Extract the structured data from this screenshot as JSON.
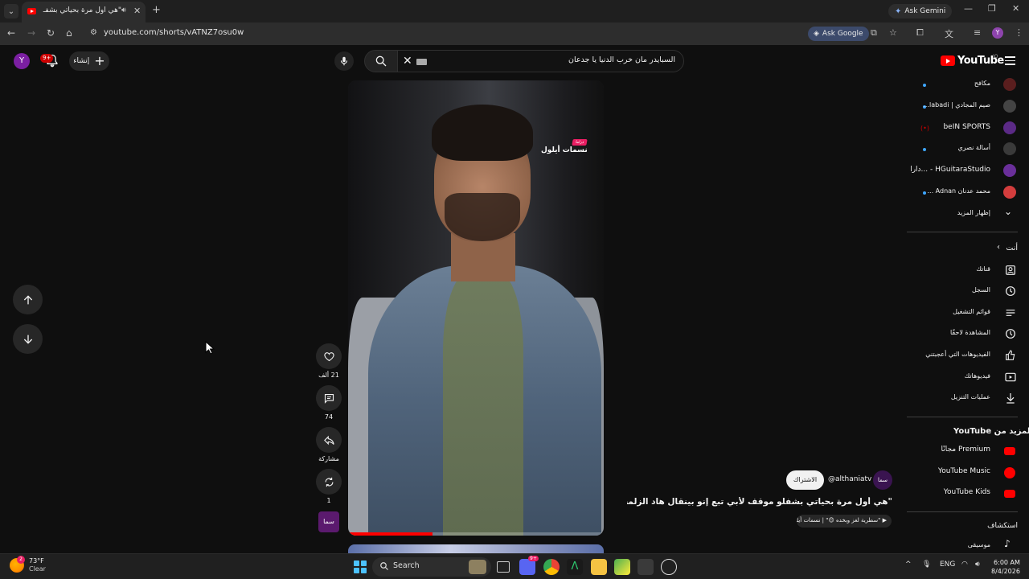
{
  "browser": {
    "tab_title": "\"هي أول مرة بحياتي بشفـ (9)",
    "new_tab_symbol": "+",
    "ask_gemini": "Ask Gemini",
    "url": "youtube.com/shorts/vATNZ7osu0w",
    "ask_google": "Ask Google",
    "profile_letter": "Y"
  },
  "header": {
    "avatar_letter": "Y",
    "notifications_badge": "9+",
    "create_label": "إنشاء",
    "search_query": "السبايدر مان خرب الدنيا يا جدعان",
    "logo_text": "YouTube",
    "logo_country": "JO"
  },
  "short": {
    "like_count": "21 ألف",
    "comment_count": "74",
    "share_label": "مشاركة",
    "remix_count": "1",
    "channel_thumb_text": "سما",
    "subscribe_label": "الاشتراك",
    "channel_handle": "@althaniatv",
    "title": "\"هي أول مرة بحياتي بشفلو موقف لأبي تبع إنو بينقال هاد الزلمة بينحط ...",
    "music": "\"سطرية لغز وبخده 😊\" | نسمات أيلول",
    "video_overlay_small": "دراما",
    "video_overlay_logo": "نسمات أيلول",
    "progress": 0.33
  },
  "sidebar": {
    "subscriptions": [
      {
        "label": "مكافح",
        "dot": true,
        "icon_color": "#5a1e1e"
      },
      {
        "label": "صيم المجادي | labadi...",
        "dot": true,
        "icon_color": "#444444"
      },
      {
        "label": "beIN SPORTS",
        "dot": false,
        "live": true,
        "icon_color": "#5b2a86"
      },
      {
        "label": "أسالة نصري",
        "dot": true,
        "icon_color": "#3a3a3a"
      },
      {
        "label": "HGuitaraStudio - ...دارا",
        "dot": false,
        "icon_color": "#6a2f9a"
      },
      {
        "label": "محمد عدنان Adnan ...",
        "dot": true,
        "icon_color": "#d33d3d"
      }
    ],
    "show_more": "إظهار المزيد",
    "you_header": "أنت",
    "you_items": [
      {
        "label": "قناتك",
        "icon": "channel-icon"
      },
      {
        "label": "السجل",
        "icon": "history-icon"
      },
      {
        "label": "قوائم التشغيل",
        "icon": "playlists-icon"
      },
      {
        "label": "المشاهدة لاحقًا",
        "icon": "watch-later-icon"
      },
      {
        "label": "الفيديوهات التي أعجبتني",
        "icon": "liked-icon"
      },
      {
        "label": "فيديوهاتك",
        "icon": "your-videos-icon"
      },
      {
        "label": "عمليات التنزيل",
        "icon": "downloads-icon"
      }
    ],
    "more_from": "المزيد من YouTube",
    "more_items": [
      {
        "label": "Premium مجانًا"
      },
      {
        "label": "YouTube Music"
      },
      {
        "label": "YouTube Kids"
      }
    ],
    "explore": "استكشاف",
    "music_item": "موسيقى"
  },
  "taskbar": {
    "temperature": "73°F",
    "condition": "Clear",
    "weather_badge": "2",
    "search_label": "Search",
    "language": "ENG",
    "time": "6:00 AM",
    "date": "8/4/2026",
    "discord_badge": "9+"
  },
  "colors": {
    "accent_red": "#ff0000",
    "background": "#0f0f0f",
    "link_blue": "#3ea6ff"
  }
}
